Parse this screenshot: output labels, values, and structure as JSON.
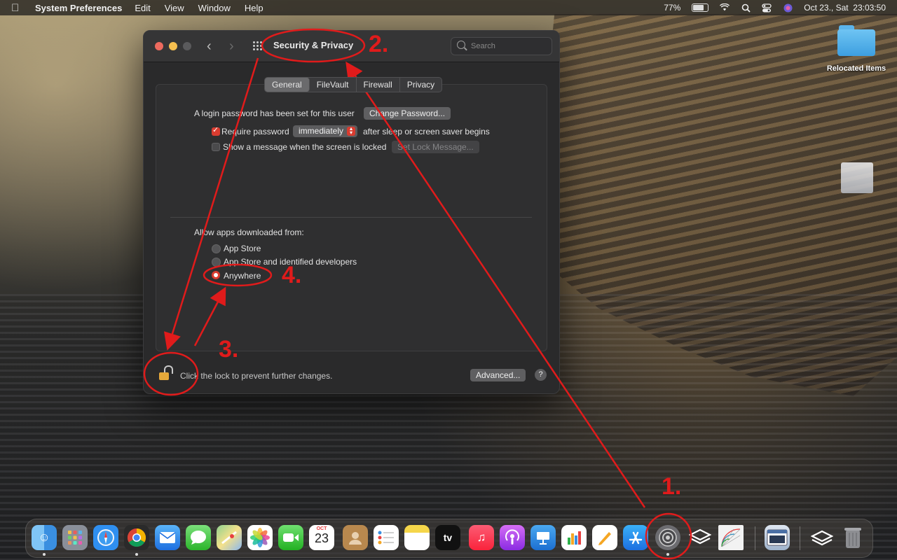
{
  "menubar": {
    "apple_icon": "apple-icon",
    "app_name": "System Preferences",
    "menus": [
      "Edit",
      "View",
      "Window",
      "Help"
    ],
    "battery": "77%",
    "battery_level": 0.77,
    "datetime": "Oct 23., Sat  23:03:50"
  },
  "desktop": {
    "folder_label": "Relocated Items"
  },
  "window": {
    "title": "Security & Privacy",
    "search_placeholder": "Search",
    "tabs": [
      "General",
      "FileVault",
      "Firewall",
      "Privacy"
    ],
    "active_tab": "General",
    "general": {
      "login_text": "A login password has been set for this user",
      "change_password_button": "Change Password...",
      "require_password_label": "Require password",
      "require_password_checked": true,
      "require_password_value": "immediately",
      "require_password_suffix": "after sleep or screen saver begins",
      "show_message_label": "Show a message when the screen is locked",
      "show_message_checked": false,
      "set_lock_message_button": "Set Lock Message...",
      "allow_apps_heading": "Allow apps downloaded from:",
      "allow_options": [
        "App Store",
        "App Store and identified developers",
        "Anywhere"
      ],
      "allow_selected": "Anywhere"
    },
    "lock_message": "Click the lock to prevent further changes.",
    "advanced_button": "Advanced...",
    "help_button": "?"
  },
  "dock": {
    "calendar_month": "OCT",
    "calendar_day": "23",
    "tv_label": "tv"
  },
  "annotations": {
    "step1": "1.",
    "step2": "2.",
    "step3": "3.",
    "step4": "4.",
    "color": "#e01b1b"
  }
}
